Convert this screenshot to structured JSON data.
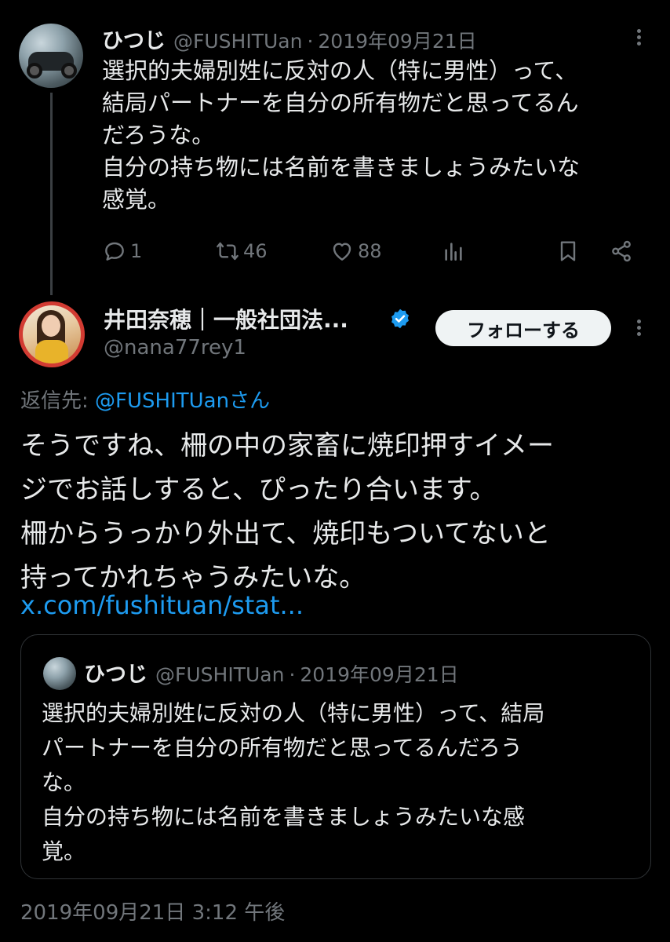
{
  "parent_tweet": {
    "name": "ひつじ",
    "handle": "@FUSHITUan",
    "separator": "·",
    "date": "2019年09月21日",
    "text_lines": [
      "選択的夫婦別姓に反対の人（特に男性）って、",
      "結局パートナーを自分の所有物だと思ってるん",
      "だろうな。",
      "自分の持ち物には名前を書きましょうみたいな",
      "感覚。"
    ],
    "actions": {
      "reply_count": "1",
      "retweet_count": "46",
      "like_count": "88"
    }
  },
  "reply_tweet": {
    "name": "井田奈穂｜一般社団法...",
    "handle": "@nana77rey1",
    "follow_label": "フォローする",
    "reply_to_prefix": "返信先: ",
    "reply_to_mention": "@FUSHITUanさん",
    "text_lines": [
      "そうですね、柵の中の家畜に焼印押すイメー",
      "ジでお話しすると、ぴったり合います。",
      "柵からうっかり外出て、焼印もついてないと",
      "持ってかれちゃうみたいな。"
    ],
    "link": "x.com/fushituan/stat...",
    "timestamp": "2019年09月21日 3:12 午後"
  },
  "quoted_tweet": {
    "name": "ひつじ",
    "handle": "@FUSHITUan",
    "separator": "·",
    "date": "2019年09月21日",
    "text_lines": [
      "選択的夫婦別姓に反対の人（特に男性）って、結局",
      "パートナーを自分の所有物だと思ってるんだろう",
      "な。",
      "自分の持ち物には名前を書きましょうみたいな感",
      "覚。"
    ]
  },
  "colors": {
    "background": "#000000",
    "text": "#e7e9ea",
    "muted": "#71767b",
    "accent": "#1d9bf0",
    "border": "#2f3336"
  },
  "icons": [
    "reply-icon",
    "retweet-icon",
    "like-icon",
    "views-icon",
    "bookmark-icon",
    "share-icon",
    "verified-badge-icon",
    "more-icon"
  ]
}
